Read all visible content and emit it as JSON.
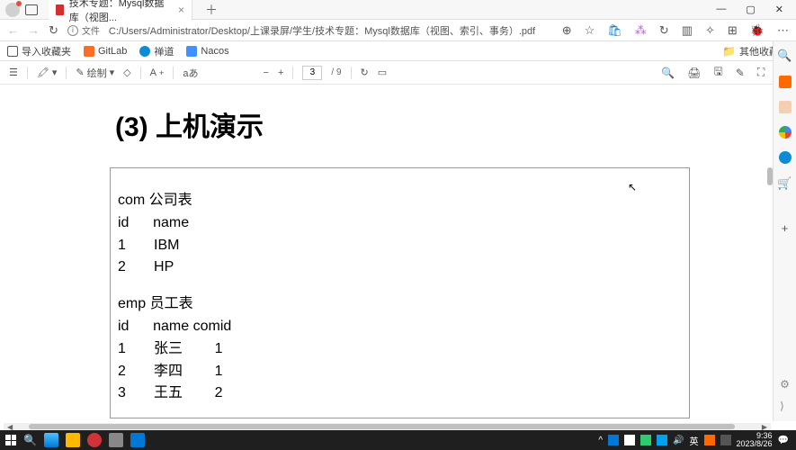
{
  "tab": {
    "title": "技术专题：Mysql数据库（视图...",
    "close": "×"
  },
  "newtab": "＋",
  "window": {
    "min": "—",
    "max": "▢",
    "close": "✕"
  },
  "address": {
    "back": "←",
    "fwd": "→",
    "reload": "↻",
    "fileLabel": "文件",
    "path": "C:/Users/Administrator/Desktop/上课录屏/学生/技术专题：Mysql数据库（视图、索引、事务）.pdf"
  },
  "bookmarks": {
    "import": "导入收藏夹",
    "gitlab": "GitLab",
    "zendao": "禅道",
    "nacos": "Nacos",
    "other": "其他收藏夹"
  },
  "pdfbar": {
    "draw": "绘制",
    "page": "3",
    "total": "/ 9",
    "minus": "−",
    "plus": "+"
  },
  "doc": {
    "heading": "(3)  上机演示",
    "l1": "com 公司表",
    "l2": "id      name",
    "l3": "1       IBM",
    "l4": "2       HP",
    "l5": "emp 员工表",
    "l6": "id      name comid",
    "l7": "1       张三        1",
    "l8": "2       李四        1",
    "l9": "3       王五        2"
  },
  "tray": {
    "up": "^",
    "time": "9:36",
    "date": "2023/8/26",
    "notif": "💬"
  }
}
